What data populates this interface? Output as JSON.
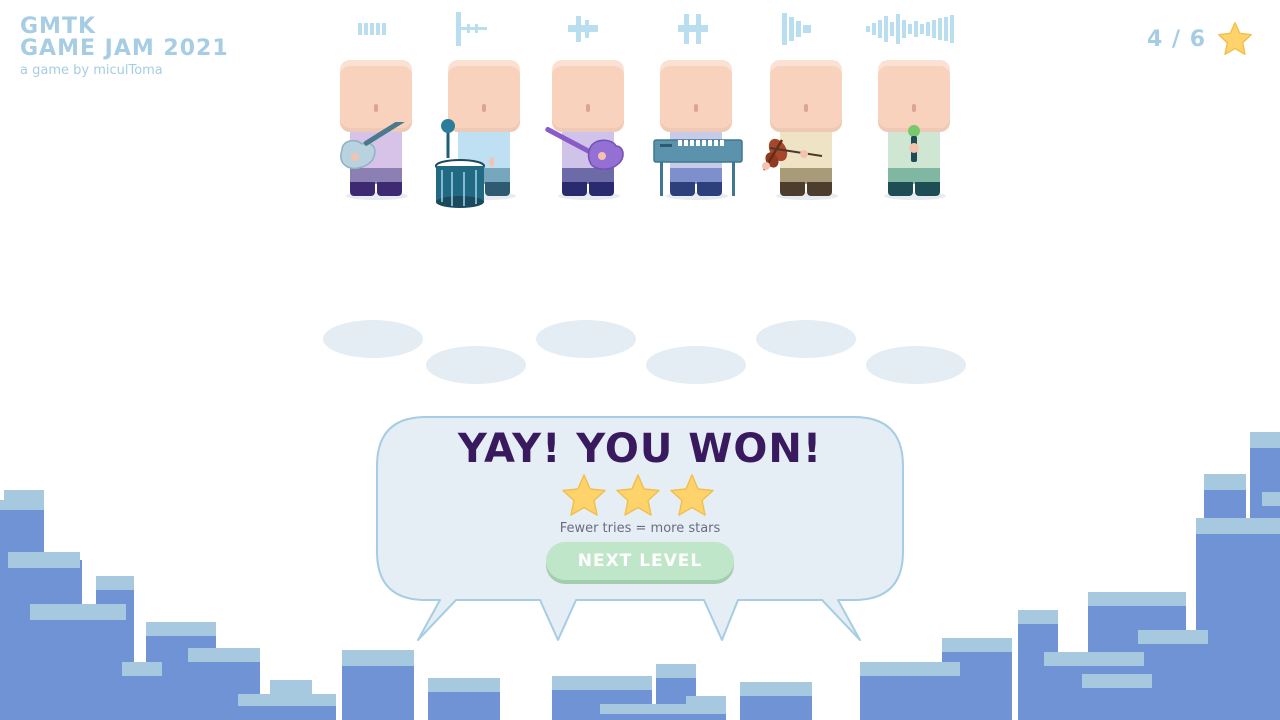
{
  "brand": {
    "line1": "GMTK",
    "line2": "GAME JAM 2021",
    "byline": "a game by miculToma"
  },
  "progress": {
    "text": "4 / 6",
    "icon": "star-icon"
  },
  "musicians": [
    {
      "name": "guitarist",
      "instrument": "electric-guitar-icon",
      "shirt": "#d7c3e8",
      "pants": "#8c7fb2",
      "shoes": "#3d2a73"
    },
    {
      "name": "drummer",
      "instrument": "drum-icon",
      "shirt": "#bfe0f3",
      "pants": "#77a7bd",
      "shoes": "#2f5b72"
    },
    {
      "name": "bassist",
      "instrument": "bass-guitar-icon",
      "shirt": "#cfc3ea",
      "pants": "#6c6aa7",
      "shoes": "#2a2a6e"
    },
    {
      "name": "keyboardist",
      "instrument": "keyboard-icon",
      "shirt": "#c7cbe8",
      "pants": "#7f8fcc",
      "shoes": "#2d3f7d"
    },
    {
      "name": "violinist",
      "instrument": "violin-icon",
      "shirt": "#efe3c6",
      "pants": "#a89b7a",
      "shoes": "#4d3d2c"
    },
    {
      "name": "singer",
      "instrument": "microphone-icon",
      "shirt": "#cfe7d2",
      "pants": "#7fb7a2",
      "shoes": "#1e4d55"
    }
  ],
  "dialog": {
    "title": "YAY! YOU WON!",
    "stars_earned": 3,
    "stars_total": 3,
    "hint": "Fewer tries = more stars",
    "next_label": "NEXT LEVEL"
  },
  "colors": {
    "title": "#3a1a5e",
    "accent_light": "#a6cde3",
    "building": "#6f93d4",
    "building_top": "#a6c9e0",
    "star": "#ffd36b",
    "button": "#bfe6c9"
  }
}
